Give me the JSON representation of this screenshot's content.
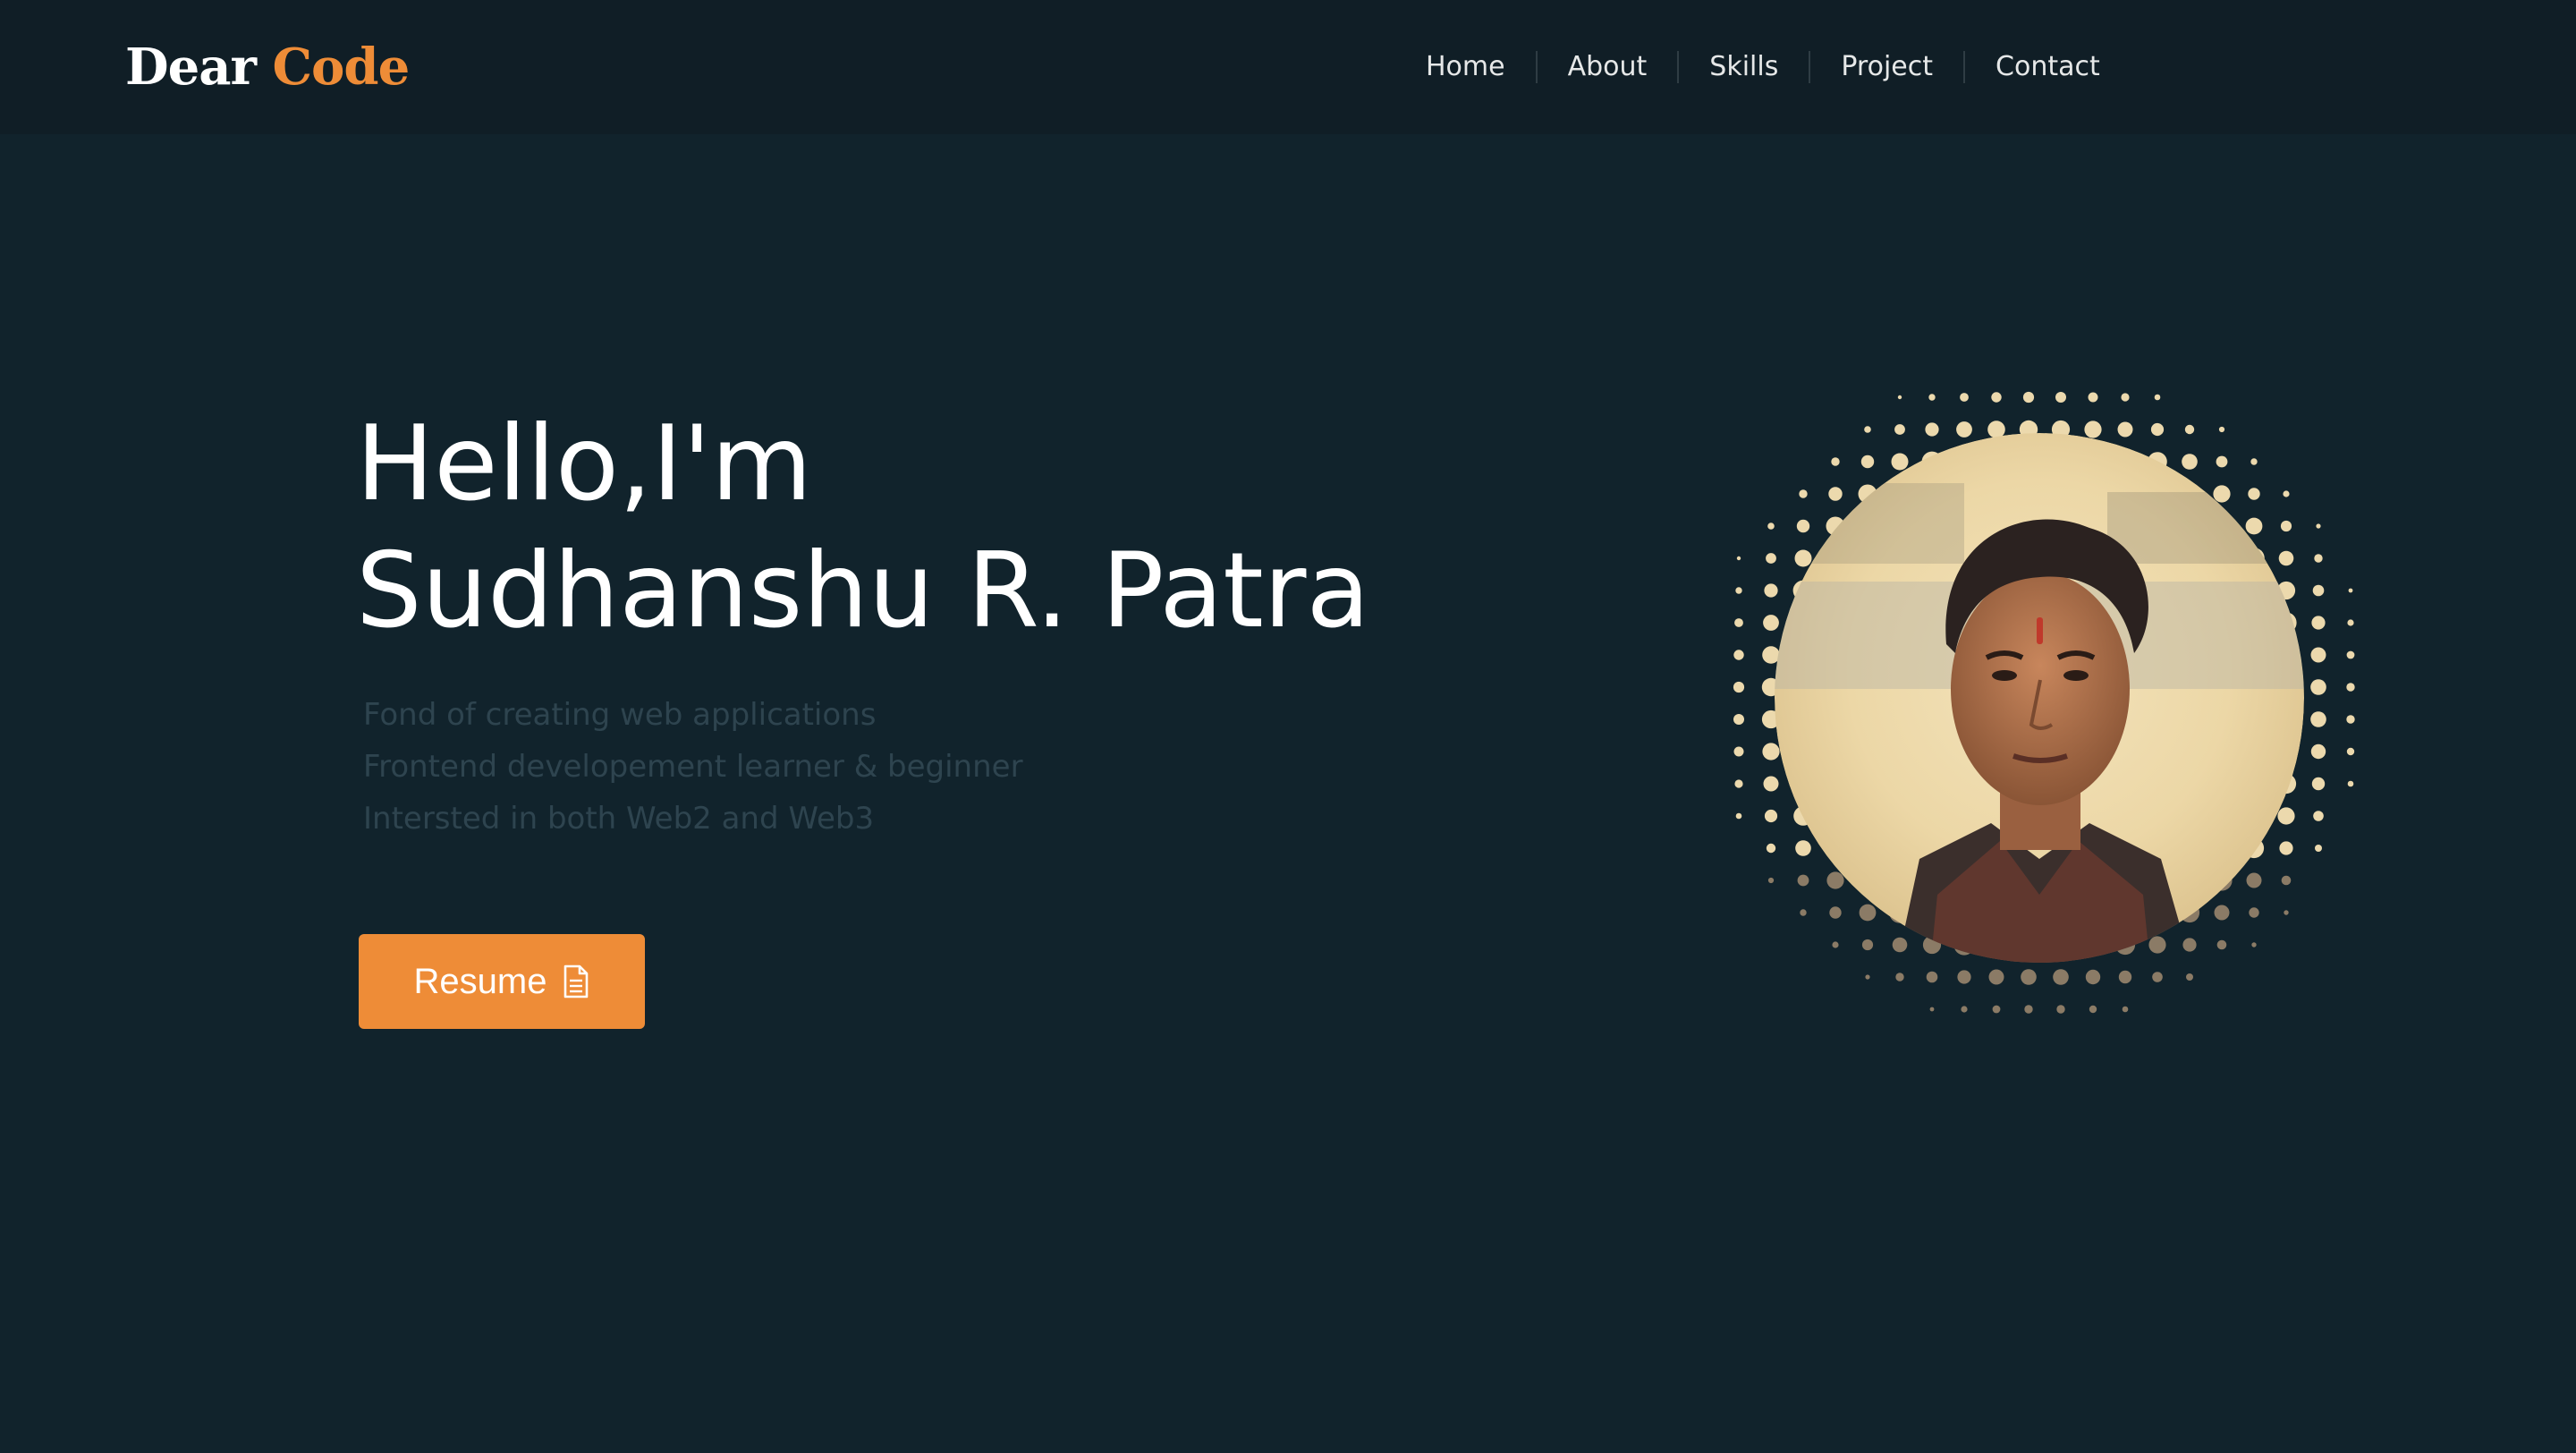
{
  "brand": {
    "part1": "Dear",
    "part2": "Code",
    "accent_color": "#ee8c37"
  },
  "nav": {
    "items": [
      "Home",
      "About",
      "Skills",
      "Project",
      "Contact"
    ]
  },
  "hero": {
    "greeting": "Hello,I'm",
    "name": "Sudhanshu R. Patra",
    "lines": [
      "Fond of creating web applications",
      "Frontend developement learner & beginner",
      "Intersted in both Web2 and Web3"
    ],
    "resume_label": "Resume",
    "resume_icon": "document-icon"
  },
  "portrait": {
    "style": "halftone-dot-circle"
  },
  "colors": {
    "background": "#11232c",
    "navbar": "#101e26",
    "accent": "#ee8c37",
    "text_primary": "#ffffff",
    "text_muted": "#2e444f"
  }
}
